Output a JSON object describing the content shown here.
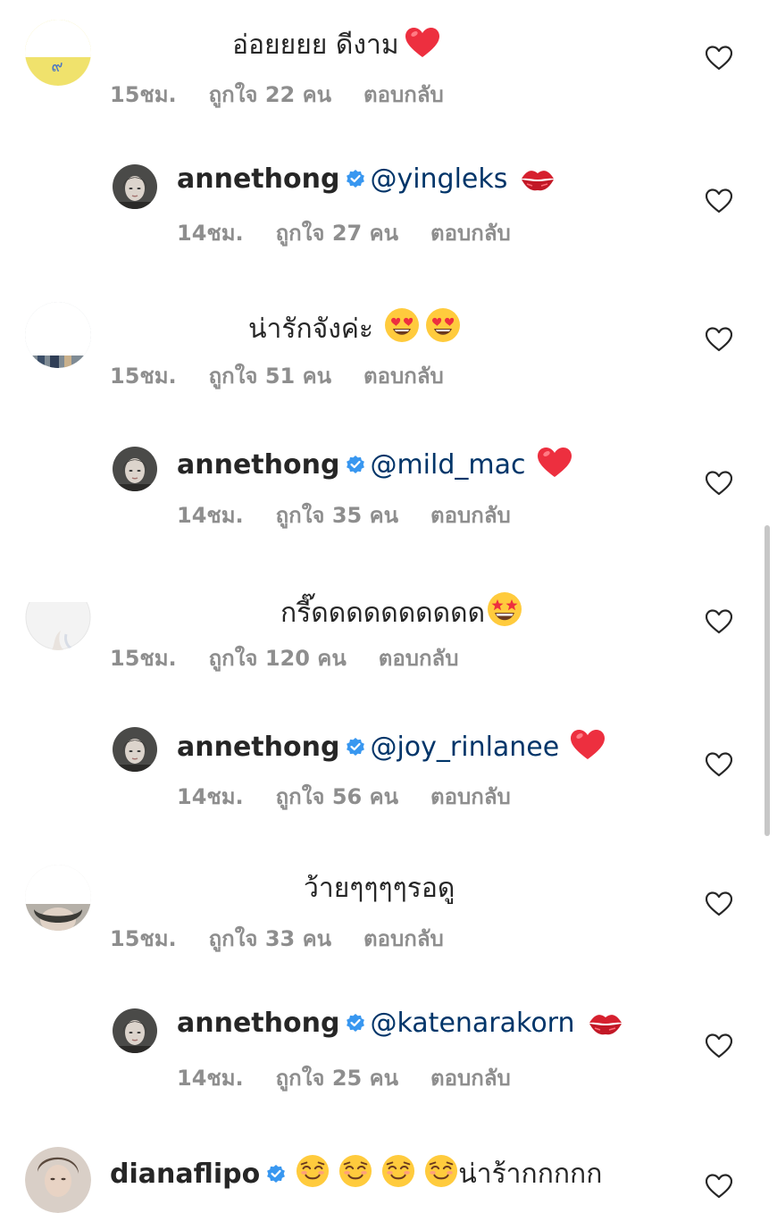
{
  "icons": {
    "heart_outline": "heart-outline-icon",
    "verified": "verified-badge-icon",
    "heart_emoji": "red-heart-emoji",
    "kiss_emoji": "kiss-mark-emoji",
    "heart_eyes_emoji": "heart-eyes-emoji",
    "star_struck_emoji": "star-struck-emoji",
    "smiling_emoji": "smiling-face-emoji"
  },
  "colors": {
    "text": "#262626",
    "meta": "#8e8e8e",
    "mention": "#003569",
    "verified": "#3897f0",
    "heart_red": "#ed2f3f"
  },
  "comments": [
    {
      "text": "อ่อยยยย ดีงาม",
      "time": "15ชม.",
      "likes": "ถูกใจ 22 คน",
      "reply": "ตอบกลับ"
    },
    {
      "user": "annethong",
      "mention": "@yingleks",
      "time": "14ชม.",
      "likes": "ถูกใจ 27 คน",
      "reply": "ตอบกลับ"
    },
    {
      "text": "น่ารักจังค่ะ",
      "time": "15ชม.",
      "likes": "ถูกใจ 51 คน",
      "reply": "ตอบกลับ"
    },
    {
      "user": "annethong",
      "mention": "@mild_mac",
      "time": "14ชม.",
      "likes": "ถูกใจ 35 คน",
      "reply": "ตอบกลับ"
    },
    {
      "text": "กรี๊ดดดดดดดดดด",
      "time": "15ชม.",
      "likes": "ถูกใจ 120 คน",
      "reply": "ตอบกลับ"
    },
    {
      "user": "annethong",
      "mention": "@joy_rinlanee",
      "time": "14ชม.",
      "likes": "ถูกใจ 56 คน",
      "reply": "ตอบกลับ"
    },
    {
      "text": "ว้ายๆๆๆๆรอดู",
      "time": "15ชม.",
      "likes": "ถูกใจ 33 คน",
      "reply": "ตอบกลับ"
    },
    {
      "user": "annethong",
      "mention": "@katenarakorn",
      "time": "14ชม.",
      "likes": "ถูกใจ 25 คน",
      "reply": "ตอบกลับ"
    },
    {
      "user": "dianaflipo",
      "text": "น่าร้ากกกกก"
    }
  ]
}
